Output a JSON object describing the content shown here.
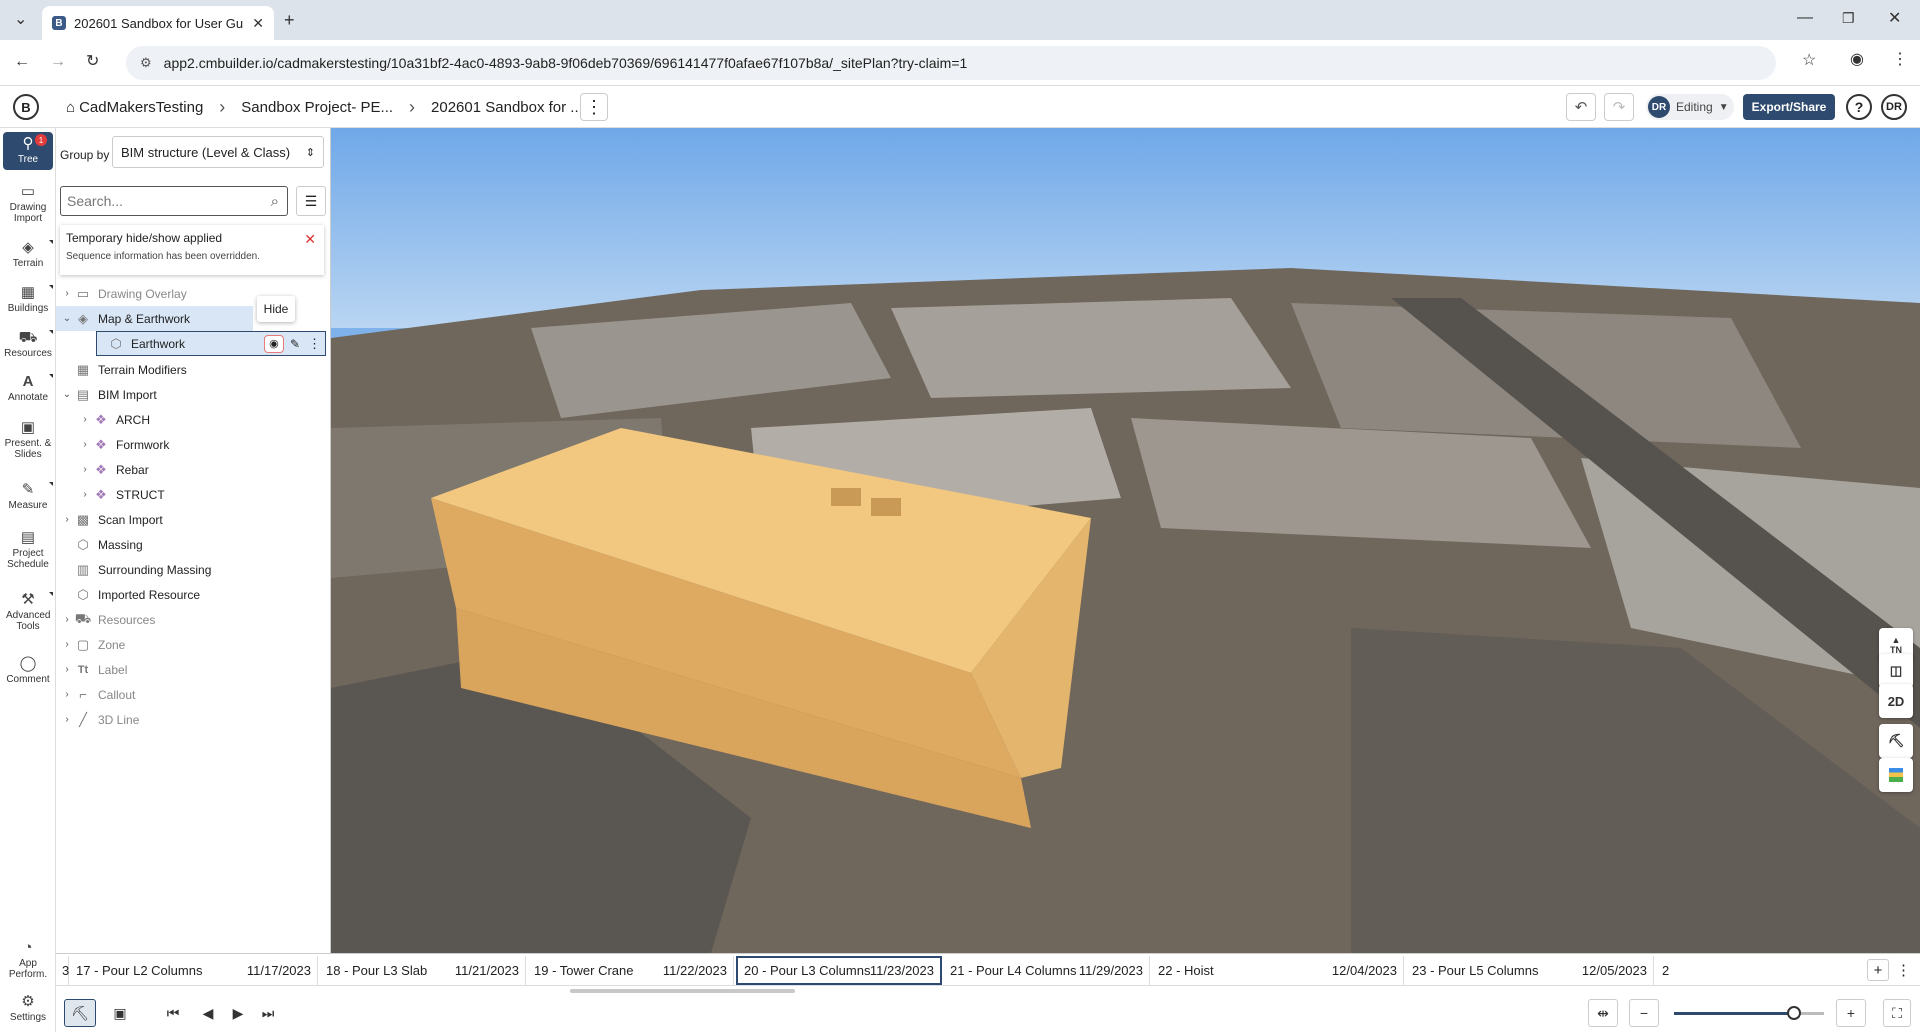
{
  "browser": {
    "tab_title": "202601 Sandbox for User Guide",
    "favicon_letter": "B",
    "url": "app2.cmbuilder.io/cadmakerstesting/10a31bf2-4ac0-4893-9ab8-9f06deb70369/696141477f0afae67f107b8a/_sitePlan?try-claim=1"
  },
  "header": {
    "breadcrumbs": [
      "CadMakersTesting",
      "Sandbox Project- PE...",
      "202601 Sandbox for ..."
    ],
    "mode_initials": "DR",
    "mode_label": "Editing",
    "export_label": "Export/Share",
    "help_label": "?",
    "user_initials": "DR"
  },
  "rail": {
    "items": [
      {
        "label": "Tree",
        "icon": "tree-icon",
        "badge": "1"
      },
      {
        "label": "Drawing Import",
        "icon": "image-icon"
      },
      {
        "label": "Terrain",
        "icon": "terrain-icon"
      },
      {
        "label": "Buildings",
        "icon": "buildings-icon"
      },
      {
        "label": "Resources",
        "icon": "resources-icon"
      },
      {
        "label": "Annotate",
        "icon": "annotate-icon",
        "glyph": "A"
      },
      {
        "label": "Present. & Slides",
        "icon": "slides-icon"
      },
      {
        "label": "Measure",
        "icon": "measure-icon"
      },
      {
        "label": "Project Schedule",
        "icon": "schedule-icon"
      },
      {
        "label": "Advanced Tools",
        "icon": "tools-icon"
      },
      {
        "label": "Comment",
        "icon": "comment-icon"
      },
      {
        "label": "App Perform.",
        "icon": "performance-icon"
      },
      {
        "label": "Settings",
        "icon": "gear-icon"
      }
    ]
  },
  "panel": {
    "group_by_label": "Group by",
    "group_by_value": "BIM structure (Level & Class)",
    "search_placeholder": "Search...",
    "notice_title": "Temporary hide/show applied",
    "notice_body": "Sequence information has been overridden.",
    "tooltip": "Hide",
    "tree": [
      {
        "label": "Drawing Overlay",
        "level": 0,
        "expandable": true,
        "dim": true
      },
      {
        "label": "Map & Earthwork",
        "level": 0,
        "expandable": true,
        "expanded": true
      },
      {
        "label": "Earthwork",
        "level": 1,
        "selected": true
      },
      {
        "label": "Terrain Modifiers",
        "level": 0
      },
      {
        "label": "BIM Import",
        "level": 0,
        "expandable": true,
        "expanded": true
      },
      {
        "label": "ARCH",
        "level": 1,
        "expandable": true
      },
      {
        "label": "Formwork",
        "level": 1,
        "expandable": true
      },
      {
        "label": "Rebar",
        "level": 1,
        "expandable": true
      },
      {
        "label": "STRUCT",
        "level": 1,
        "expandable": true
      },
      {
        "label": "Scan Import",
        "level": 0,
        "expandable": true
      },
      {
        "label": "Massing",
        "level": 0
      },
      {
        "label": "Surrounding Massing",
        "level": 0
      },
      {
        "label": "Imported Resource",
        "level": 0
      },
      {
        "label": "Resources",
        "level": 0,
        "expandable": true,
        "dim": true
      },
      {
        "label": "Zone",
        "level": 0,
        "expandable": true,
        "dim": true
      },
      {
        "label": "Label",
        "level": 0,
        "expandable": true,
        "dim": true
      },
      {
        "label": "Callout",
        "level": 0,
        "expandable": true,
        "dim": true
      },
      {
        "label": "3D Line",
        "level": 0,
        "expandable": true,
        "dim": true
      }
    ]
  },
  "viewport": {
    "north_label": "TN",
    "view_2d_label": "2D"
  },
  "timeline": {
    "steps": [
      {
        "name": "3",
        "date": ""
      },
      {
        "name": "17 - Pour L2 Columns",
        "date": "11/17/2023"
      },
      {
        "name": "18 - Pour L3 Slab",
        "date": "11/21/2023"
      },
      {
        "name": "19 - Tower Crane",
        "date": "11/22/2023"
      },
      {
        "name": "20 - Pour L3 Columns",
        "date": "11/23/2023",
        "current": true
      },
      {
        "name": "21 - Pour L4 Columns",
        "date": "11/29/2023"
      },
      {
        "name": "22 - Hoist",
        "date": "12/04/2023"
      },
      {
        "name": "23 - Pour L5 Columns",
        "date": "12/05/2023"
      },
      {
        "name": "2",
        "date": ""
      }
    ],
    "zoom_level": 0.8
  }
}
